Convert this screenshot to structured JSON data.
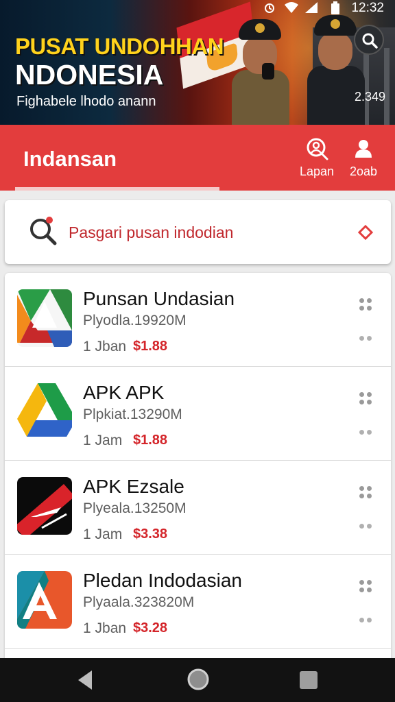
{
  "status_bar": {
    "time": "12:32",
    "icons": [
      "alarm-icon",
      "wifi-icon",
      "signal-icon",
      "battery-icon"
    ]
  },
  "banner": {
    "title_line1": "PUSAT UNDOHHAN",
    "title_line2": "NDONESIA",
    "subtitle": "Fighabele lhodo anann",
    "count": "2.349",
    "search_icon": "search-icon"
  },
  "app_bar": {
    "title": "Indansan",
    "actions": [
      {
        "label": "Lapan",
        "icon": "search-icon"
      },
      {
        "label": "2oab",
        "icon": "profile-icon"
      }
    ]
  },
  "search": {
    "placeholder": "Pasgari pusan indodian",
    "icon": "search-icon",
    "trailing_icon": "diamond-icon"
  },
  "apps": [
    {
      "name": "Punsan Undasian",
      "meta": "Plyodla.19920M",
      "time": "1 Jban",
      "price": "$1.88",
      "icon": "drive-style-icon"
    },
    {
      "name": "APK APK",
      "meta": "Plpkiat.13290M",
      "time": "1 Jam",
      "price": "$1.88",
      "icon": "drive-triangle-icon"
    },
    {
      "name": "APK Ezsale",
      "meta": "Plyeala.13250M",
      "time": "1 Jam",
      "price": "$3.38",
      "icon": "ezsale-icon"
    },
    {
      "name": "Pledan Indodasian",
      "meta": "Plyaala.323820M",
      "time": "1 Jban",
      "price": "$3.28",
      "icon": "letter-a-icon"
    }
  ],
  "nav_bar": {
    "buttons": [
      "back-icon",
      "home-icon",
      "recents-icon"
    ]
  },
  "colors": {
    "accent": "#e33d3d",
    "price": "#d4252a",
    "banner_title": "#ffd21c"
  }
}
